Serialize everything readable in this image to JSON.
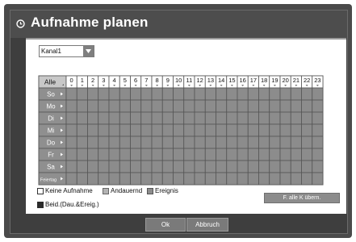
{
  "dialog": {
    "title": "Aufnahme planen"
  },
  "channel": {
    "selected": "Kanal1"
  },
  "grid": {
    "all_label": "Alle",
    "hours": [
      "0",
      "1",
      "2",
      "3",
      "4",
      "5",
      "6",
      "7",
      "8",
      "9",
      "10",
      "11",
      "12",
      "13",
      "14",
      "15",
      "16",
      "17",
      "18",
      "19",
      "20",
      "21",
      "22",
      "23"
    ],
    "days": [
      "So",
      "Mo",
      "Di",
      "Mi",
      "Do",
      "Fr",
      "Sa",
      "Feiertag"
    ],
    "cell_state": "event"
  },
  "legend": {
    "none_label": "Keine Aufnahme",
    "continuous_label": "Andauernd",
    "event_label": "Ereignis",
    "both_label": "Beid.(Dau.&Ereig.)"
  },
  "copy_button": {
    "label": "F. alle K übern."
  },
  "buttons": {
    "ok_label": "Ok",
    "cancel_label": "Abbruch"
  },
  "colors": {
    "event": "#8c8c8c",
    "continuous": "#b3b3b3",
    "none": "#ffffff",
    "both": "#2b2b2b"
  }
}
